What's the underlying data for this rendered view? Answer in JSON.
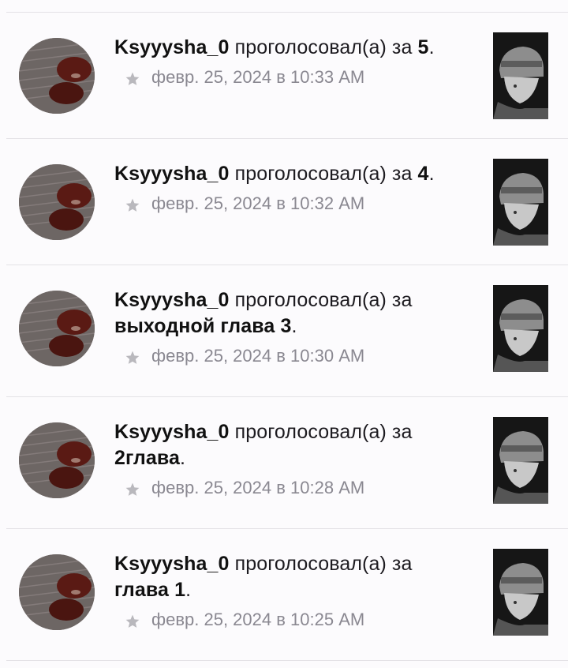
{
  "activity": {
    "items": [
      {
        "username": "Ksyyysha_0",
        "action": " проголосовал(а) за ",
        "target": "5",
        "suffix": ".",
        "time": "февр. 25, 2024 в 10:33 AM"
      },
      {
        "username": "Ksyyysha_0",
        "action": " проголосовал(а) за ",
        "target": "4",
        "suffix": ".",
        "time": "февр. 25, 2024 в 10:32 AM"
      },
      {
        "username": "Ksyyysha_0",
        "action": " проголосовал(а) за ",
        "target": "выходной глава 3",
        "suffix": ".",
        "time": "февр. 25, 2024 в 10:30 AM"
      },
      {
        "username": "Ksyyysha_0",
        "action": " проголосовал(а) за ",
        "target": "2глава",
        "suffix": ".",
        "time": "февр. 25, 2024 в 10:28 AM"
      },
      {
        "username": "Ksyyysha_0",
        "action": " проголосовал(а) за ",
        "target": "глава 1",
        "suffix": ".",
        "time": "февр. 25, 2024 в 10:25 AM"
      }
    ]
  },
  "icons": {
    "vote": "star-icon",
    "avatar": "user-avatar",
    "cover": "story-cover"
  },
  "colors": {
    "background": "#fcfbfd",
    "text": "#1d1b20",
    "meta": "#8a8891",
    "star": "#b9b8bd",
    "divider": "#e4e2e6"
  }
}
